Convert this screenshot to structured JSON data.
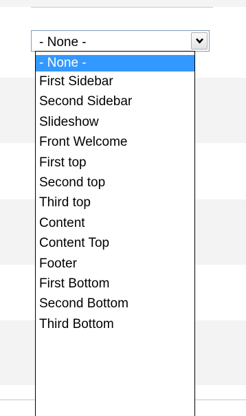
{
  "select": {
    "value": "- None -",
    "arrow_icon": "chevron-down-icon"
  },
  "dropdown": {
    "selected_index": 0,
    "options": [
      "- None -",
      "First Sidebar",
      "Second Sidebar",
      "Slideshow",
      "Front Welcome",
      "First top",
      "Second top",
      "Third top",
      "Content",
      "Content Top",
      "Footer",
      "First Bottom",
      "Second Bottom",
      "Third Bottom"
    ]
  },
  "colors": {
    "selection_highlight": "#3399ff",
    "select_border": "#7f9db9",
    "row_stripe": "#f3f3f3"
  }
}
